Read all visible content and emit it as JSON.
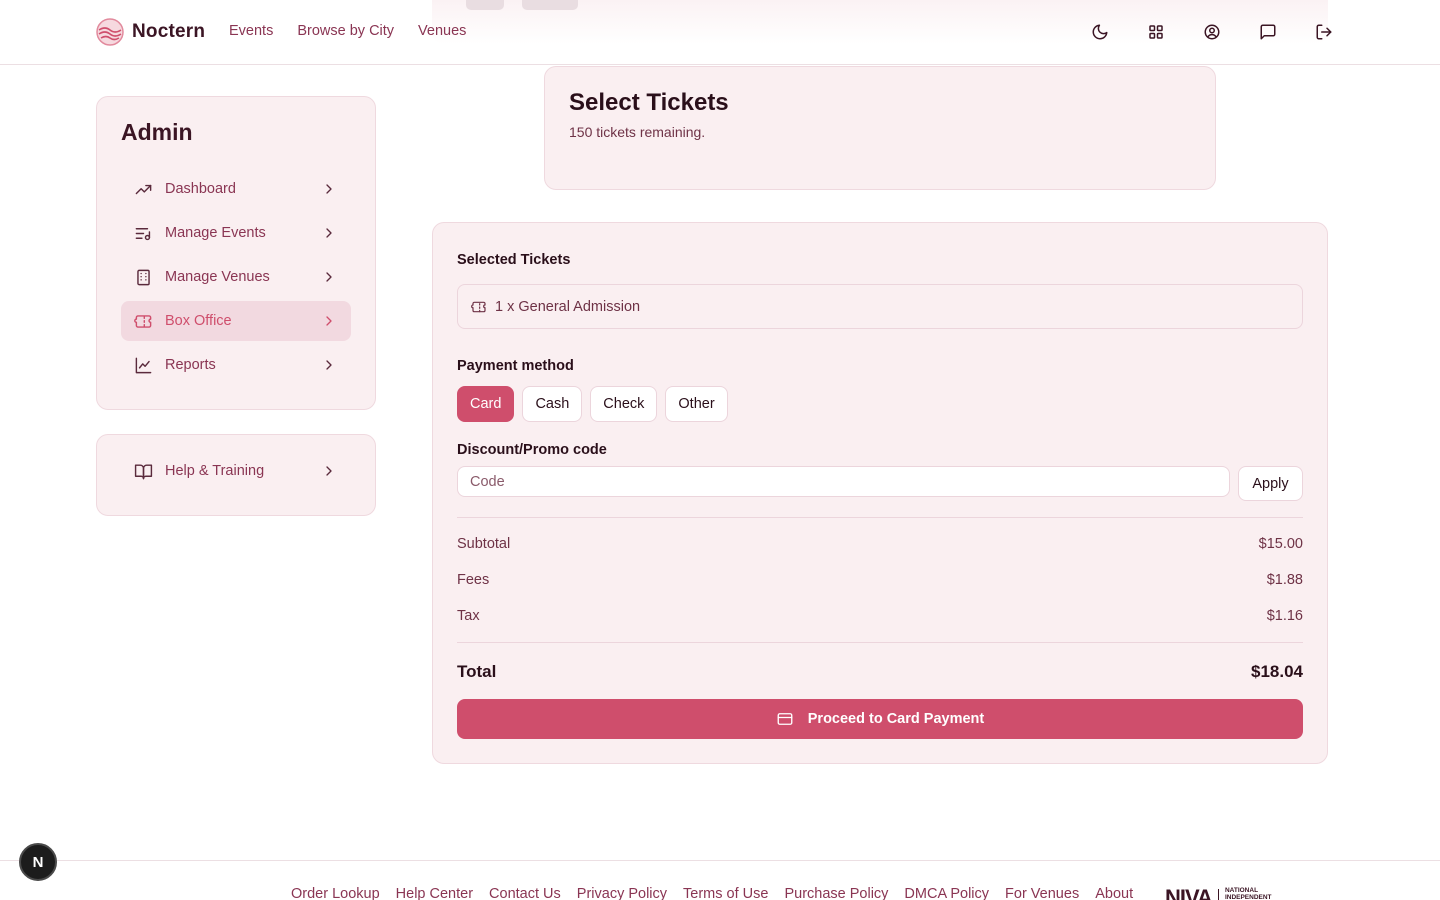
{
  "brand": {
    "name": "Noctern",
    "accent": "#cf4e6c"
  },
  "nav": {
    "events": "Events",
    "browse_by_city": "Browse by City",
    "venues": "Venues"
  },
  "header_icons": [
    "moon-icon",
    "grid-icon",
    "user-circle-icon",
    "message-icon",
    "logout-icon"
  ],
  "sidebar": {
    "title": "Admin",
    "items": [
      {
        "label": "Dashboard",
        "icon": "trending-up-icon"
      },
      {
        "label": "Manage Events",
        "icon": "list-music-icon"
      },
      {
        "label": "Manage Venues",
        "icon": "building-icon"
      },
      {
        "label": "Box Office",
        "icon": "ticket-icon",
        "active": true
      },
      {
        "label": "Reports",
        "icon": "chart-line-icon"
      }
    ],
    "help": {
      "label": "Help & Training",
      "icon": "book-icon"
    }
  },
  "tickets": {
    "title": "Select Tickets",
    "remaining": "150 tickets remaining."
  },
  "checkout": {
    "selected_label": "Selected Tickets",
    "selected_item": "1 x General Admission",
    "payment_label": "Payment method",
    "payment_methods": [
      "Card",
      "Cash",
      "Check",
      "Other"
    ],
    "payment_selected": "Card",
    "promo_label": "Discount/Promo code",
    "promo_placeholder": "Code",
    "promo_value": "",
    "apply_label": "Apply",
    "subtotal_label": "Subtotal",
    "subtotal_value": "$15.00",
    "fees_label": "Fees",
    "fees_value": "$1.88",
    "tax_label": "Tax",
    "tax_value": "$1.16",
    "total_label": "Total",
    "total_value": "$18.04",
    "proceed_label": "Proceed to Card Payment"
  },
  "footer": {
    "links": [
      "Order Lookup",
      "Help Center",
      "Contact Us",
      "Privacy Policy",
      "Terms of Use",
      "Purchase Policy",
      "DMCA Policy",
      "For Venues",
      "About"
    ],
    "partner_logo": "NIVA NATIONAL INDEPENDENT"
  },
  "dev_badge": "N"
}
